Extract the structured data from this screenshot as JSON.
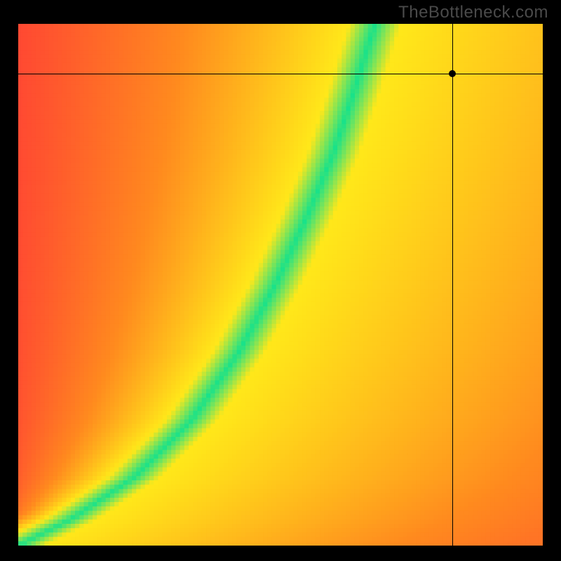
{
  "watermark": "TheBottleneck.com",
  "chart_data": {
    "type": "heatmap",
    "title": "",
    "xlabel": "",
    "ylabel": "",
    "xlim": [
      0,
      1
    ],
    "ylim": [
      0,
      1
    ],
    "grid_resolution": 120,
    "color_scale_note": "values 0→1 map red→orange→yellow→green (green = optimal / no bottleneck)",
    "ridge_note": "green optimal ridge is a curve from bottom-left to upper-middle; right of ridge fades yellow→orange, left fades yellow→red",
    "ridge_samples": [
      {
        "x": 0.0,
        "y": 0.0
      },
      {
        "x": 0.1,
        "y": 0.05
      },
      {
        "x": 0.22,
        "y": 0.13
      },
      {
        "x": 0.33,
        "y": 0.24
      },
      {
        "x": 0.42,
        "y": 0.37
      },
      {
        "x": 0.49,
        "y": 0.5
      },
      {
        "x": 0.55,
        "y": 0.63
      },
      {
        "x": 0.6,
        "y": 0.75
      },
      {
        "x": 0.64,
        "y": 0.87
      },
      {
        "x": 0.68,
        "y": 1.0
      }
    ],
    "ridge_half_width": 0.05,
    "marker": {
      "x": 0.827,
      "y": 0.905
    },
    "crosshair": {
      "x": 0.827,
      "y": 0.905
    },
    "colors": {
      "red": "#ff2a3c",
      "orange": "#ff8a1f",
      "yellow": "#ffe81a",
      "green": "#19e28a"
    }
  }
}
